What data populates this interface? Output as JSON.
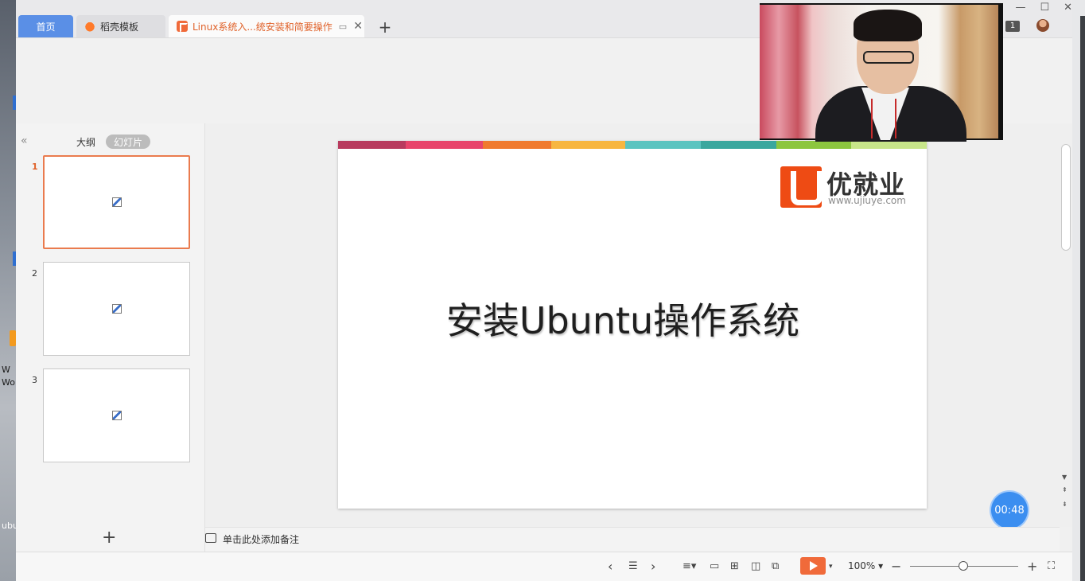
{
  "tabs": {
    "home": "首页",
    "templates": "稻壳模板",
    "document": "Linux系统入...统安装和简要操作"
  },
  "window_controls": {
    "badge": "1"
  },
  "left_panel": {
    "tab_outline": "大纲",
    "tab_slides": "幻灯片",
    "slides": [
      {
        "number": "1",
        "selected": true
      },
      {
        "number": "2"
      },
      {
        "number": "3"
      }
    ]
  },
  "slide": {
    "logo_cn": "优就业",
    "logo_url": "www.ujiuye.com",
    "title": "安装Ubuntu操作系统",
    "color_bar": [
      "#b83b5e",
      "#e8456b",
      "#f07a2e",
      "#f7b640",
      "#5bc4c0",
      "#3aa79e",
      "#8cc63f",
      "#c8e68a"
    ]
  },
  "notes": {
    "placeholder": "单击此处添加备注"
  },
  "statusbar": {
    "zoom": "100%"
  },
  "timer": "00:48",
  "desktop": {
    "labels": [
      "W",
      "Wo",
      "ubu"
    ]
  },
  "colors": {
    "accent": "#f06a3a",
    "home_tab": "#5a8fe6",
    "timer": "#3b8ef0"
  }
}
